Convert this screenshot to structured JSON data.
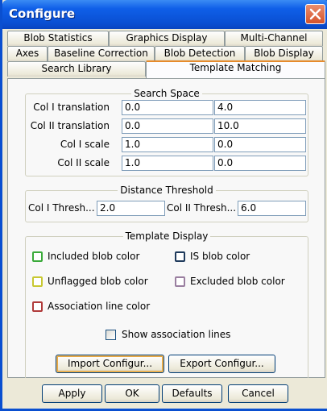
{
  "window": {
    "title": "Configure"
  },
  "tabs": {
    "row1": [
      "Blob Statistics",
      "Graphics Display",
      "Multi-Channel"
    ],
    "row2": [
      "Axes",
      "Baseline Correction",
      "Blob Detection",
      "Blob Display"
    ],
    "row3": [
      "Search Library",
      "Template Matching"
    ],
    "active": "Template Matching"
  },
  "search_space": {
    "title": "Search Space",
    "rows": [
      {
        "label": "Col I translation",
        "v1": "0.0",
        "v2": "4.0"
      },
      {
        "label": "Col II translation",
        "v1": "0.0",
        "v2": "10.0"
      },
      {
        "label": "Col I scale",
        "v1": "1.0",
        "v2": "0.0"
      },
      {
        "label": "Col II scale",
        "v1": "1.0",
        "v2": "0.0"
      }
    ]
  },
  "distance_threshold": {
    "title": "Distance Threshold",
    "col1_label": "Col I Thresh...",
    "col1_value": "2.0",
    "col2_label": "Col II Thresh...",
    "col2_value": "6.0"
  },
  "template_display": {
    "title": "Template Display",
    "included": {
      "label": "Included blob color",
      "color": "#3aaa3a"
    },
    "is_blob": {
      "label": "IS blob color",
      "color": "#1f3a5c"
    },
    "unflagged": {
      "label": "Unflagged blob color",
      "color": "#c8c832"
    },
    "excluded": {
      "label": "Excluded blob color",
      "color": "#9a7fa0"
    },
    "association": {
      "label": "Association line color",
      "color": "#b03a3a"
    },
    "show_lines": {
      "label": "Show association lines",
      "checked": false
    }
  },
  "buttons": {
    "import": "Import Configur...",
    "export": "Export Configur...",
    "apply": "Apply",
    "ok": "OK",
    "defaults": "Defaults",
    "cancel": "Cancel"
  }
}
